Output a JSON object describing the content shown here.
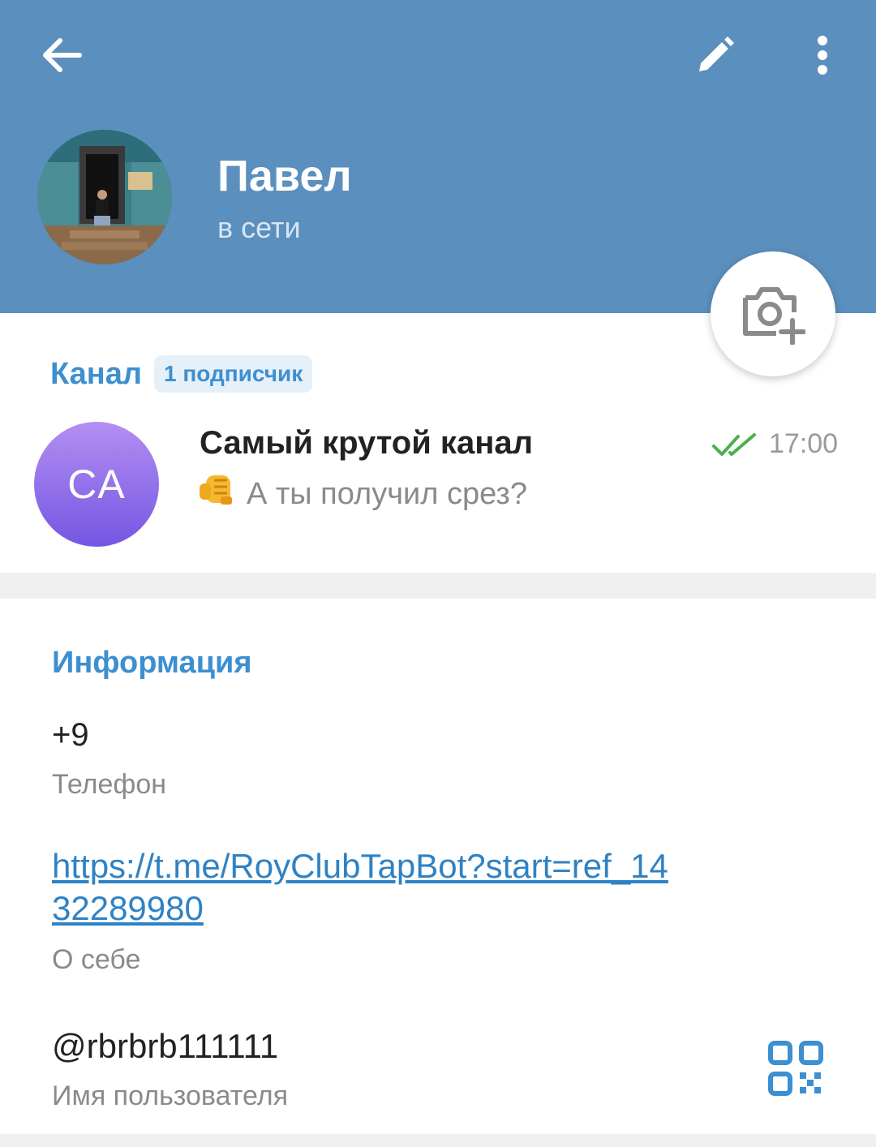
{
  "header": {
    "name": "Павел",
    "status": "в сети",
    "icons": {
      "back": "arrow-back-icon",
      "edit": "pencil-icon",
      "more": "more-vertical-icon",
      "camera": "camera-add-icon"
    }
  },
  "channel": {
    "section_label": "Канал",
    "subscribers": "1 подписчик",
    "avatar_initials": "CA",
    "title": "Самый крутой канал",
    "preview_text": "А ты получил срез?",
    "preview_emoji": "👊",
    "time": "17:00",
    "read_status_icon": "double-check-icon"
  },
  "info": {
    "section_label": "Информация",
    "phone": "+9",
    "phone_caption": "Телефон",
    "bio": "https://t.me/RoyClubTapBot?start=ref_1432289980",
    "bio_caption": "О себе",
    "username": "@rbrbrb111111",
    "username_caption": "Имя пользователя",
    "qr_icon": "qr-code-icon"
  },
  "colors": {
    "header_bg": "#5b8fbd",
    "accent": "#3d8fd0",
    "link": "#2f82c4",
    "check": "#4caf50"
  }
}
